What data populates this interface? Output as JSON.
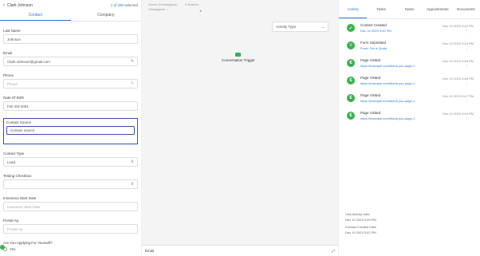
{
  "left": {
    "contact_name": "Clark Johnson",
    "selected_prefix": "1 of ",
    "selected_count": "280",
    "selected_suffix": " selected",
    "tabs": [
      "Contact",
      "Company"
    ],
    "fields": {
      "last_name": {
        "label": "Last Name",
        "value": "Johnson"
      },
      "email": {
        "label": "Email",
        "value": "Clark.Johnson@gmail.com"
      },
      "phone": {
        "label": "Phone",
        "value": "Phone"
      },
      "date_of_birth": {
        "label": "Date Of Birth",
        "value": "Feb 3rd 2001"
      },
      "contact_source": {
        "label": "Contact Source",
        "value": "Contact source"
      },
      "contact_type": {
        "label": "Contact Type",
        "value": "Lead"
      },
      "testing_checkbox": {
        "label": "Testing Checkbox",
        "value": ""
      },
      "insurance_start_date": {
        "label": "Insurance Start Date",
        "value": "Insurance Start Date"
      },
      "postal_ag": {
        "label": "Postal Ag",
        "value": "Postal Ag"
      },
      "applying_question": {
        "label": "Are You Applying For Yourself?",
        "option": "Yes"
      }
    }
  },
  "middle": {
    "top_line1": "Owner (Unassigned)",
    "top_line2": "Unassigned ⌄",
    "top_right": "Followers",
    "plus": "+",
    "activity_button": "Activity Type",
    "activity_chevron": "⌄",
    "trigger_label": "Conversation Trigger",
    "email_label": "Email",
    "expand_icon": "⤢"
  },
  "right": {
    "tabs": [
      "Activity",
      "Tasks",
      "Notes",
      "Appointments",
      "Documents"
    ],
    "activities": [
      {
        "title": "Contact Created",
        "sub": "Dec 10 2023 3:42 PM",
        "time": "Dec 10 2023 3:42 PM"
      },
      {
        "title": "Form Submitted",
        "sub": "Form: Get a Quote",
        "time": "Dec 10 2023 3:44 PM"
      },
      {
        "title": "Page Visited",
        "sub": "https://example.com/thank-you-page-1",
        "time": "Dec 10 2023 3:45 PM"
      },
      {
        "title": "Page Visited",
        "sub": "https://example.com/thank-you-page-1",
        "time": "Dec 10 2023 3:46 PM"
      },
      {
        "title": "Page Visited",
        "sub": "https://example.com/thank-you-page-1",
        "time": "Dec 10 2023 3:47 PM"
      },
      {
        "title": "Page Visited",
        "sub": "https://example.com/thank-you-page-1",
        "time": "Dec 10 2023 3:49 PM"
      }
    ],
    "last_activity_label": "Last Activity Date",
    "last_activity_value": "Dec 10 2023 3:49 PM",
    "contact_created_label": "Contact Created Date",
    "contact_created_value": "Dec 10 2023 3:42 PM"
  }
}
